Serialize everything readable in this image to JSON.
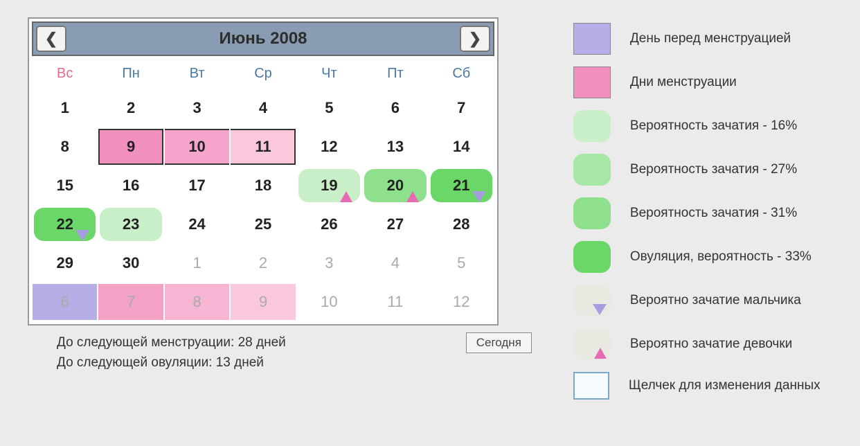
{
  "calendar": {
    "title": "Июнь 2008",
    "dow": [
      "Вс",
      "Пн",
      "Вт",
      "Ср",
      "Чт",
      "Пт",
      "Сб"
    ],
    "rows": [
      [
        {
          "n": "1"
        },
        {
          "n": "2"
        },
        {
          "n": "3"
        },
        {
          "n": "4"
        },
        {
          "n": "5"
        },
        {
          "n": "6"
        },
        {
          "n": "7"
        }
      ],
      [
        {
          "n": "8"
        },
        {
          "n": "9",
          "type": "menst-strong"
        },
        {
          "n": "10",
          "type": "menst-med"
        },
        {
          "n": "11",
          "type": "menst-light"
        },
        {
          "n": "12"
        },
        {
          "n": "13"
        },
        {
          "n": "14"
        }
      ],
      [
        {
          "n": "15"
        },
        {
          "n": "16"
        },
        {
          "n": "17"
        },
        {
          "n": "18"
        },
        {
          "n": "19",
          "type": "fertile-16",
          "marker": "pink"
        },
        {
          "n": "20",
          "type": "fertile-31",
          "marker": "pink"
        },
        {
          "n": "21",
          "type": "ovulation",
          "marker": "purple"
        }
      ],
      [
        {
          "n": "22",
          "type": "ovulation",
          "marker": "purple"
        },
        {
          "n": "23",
          "type": "fertile-16"
        },
        {
          "n": "24"
        },
        {
          "n": "25"
        },
        {
          "n": "26"
        },
        {
          "n": "27"
        },
        {
          "n": "28"
        }
      ],
      [
        {
          "n": "29"
        },
        {
          "n": "30"
        },
        {
          "n": "1",
          "other": true
        },
        {
          "n": "2",
          "other": true
        },
        {
          "n": "3",
          "other": true
        },
        {
          "n": "4",
          "other": true
        },
        {
          "n": "5",
          "other": true
        }
      ],
      [
        {
          "n": "6",
          "other": true,
          "type": "premenst",
          "shape": "rect"
        },
        {
          "n": "7",
          "other": true,
          "type": "menst-next1",
          "shape": "rect"
        },
        {
          "n": "8",
          "other": true,
          "type": "menst-next2",
          "shape": "rect"
        },
        {
          "n": "9",
          "other": true,
          "type": "menst-next3",
          "shape": "rect"
        },
        {
          "n": "10",
          "other": true
        },
        {
          "n": "11",
          "other": true
        },
        {
          "n": "12",
          "other": true
        }
      ]
    ]
  },
  "info": {
    "line1": "До следующей менструации: 28 дней",
    "line2": "До следующей овуляции: 13 дней",
    "today_btn": "Сегодня"
  },
  "legend": [
    {
      "swatch": "premenst",
      "shape": "square",
      "text": "День перед менструацией"
    },
    {
      "swatch": "menst-strong-plain",
      "shape": "square",
      "text": "Дни менструации"
    },
    {
      "swatch": "fertile-16",
      "text": "Вероятность зачатия - 16%"
    },
    {
      "swatch": "fertile-27",
      "text": "Вероятность зачатия - 27%"
    },
    {
      "swatch": "fertile-31",
      "text": "Вероятность зачатия - 31%"
    },
    {
      "swatch": "ovulation",
      "text": "Овуляция, вероятность - 33%"
    },
    {
      "swatch": "pale",
      "marker": "purple",
      "text": "Вероятно зачатие мальчика"
    },
    {
      "swatch": "pale",
      "marker": "pink",
      "text": "Вероятно зачатие девочки"
    },
    {
      "swatch": "click",
      "text": "Щелчек для изменения данных"
    }
  ]
}
